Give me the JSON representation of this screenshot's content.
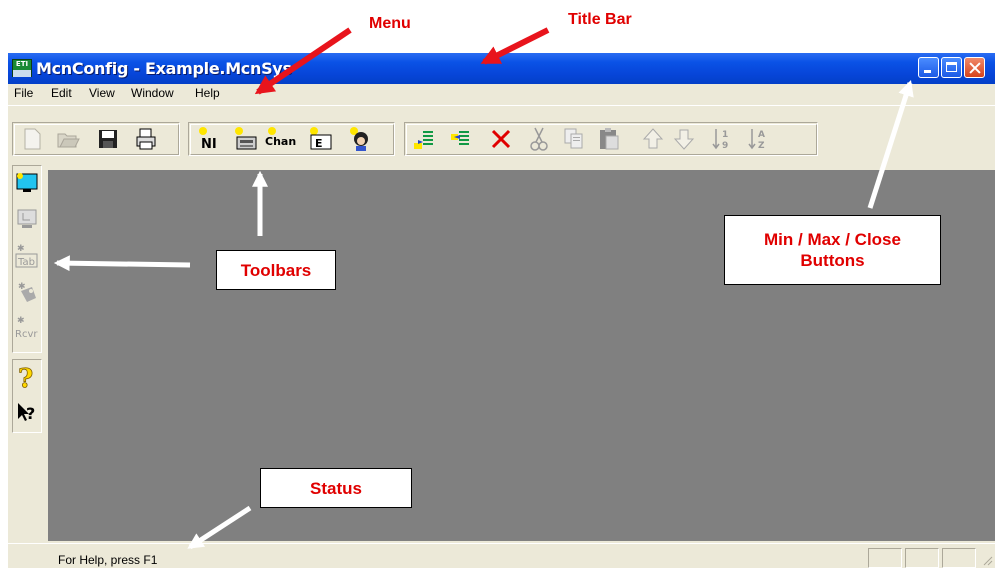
{
  "annotations": {
    "menu": "Menu",
    "title_bar": "Title Bar",
    "toolbars": "Toolbars",
    "minmaxclose_line1": "Min / Max / Close",
    "minmaxclose_line2": "Buttons",
    "status": "Status",
    "label_color": "#e00000",
    "arrow_red": "#e8141c",
    "arrow_white": "#ffffff"
  },
  "window": {
    "title": "McnConfig - Example.McnSys",
    "icon": "eti-app-icon",
    "titlebar_color": "#0a52e6",
    "client_color": "#808080"
  },
  "menu": [
    "File",
    "Edit",
    "View",
    "Window",
    "Help"
  ],
  "toolbar": {
    "buttons": [
      {
        "name": "new-icon",
        "enabled": false
      },
      {
        "name": "open-icon",
        "enabled": false
      },
      {
        "name": "save-icon",
        "enabled": true
      },
      {
        "name": "print-icon",
        "enabled": true
      },
      {
        "name": "new-ni-icon",
        "label": "NI"
      },
      {
        "name": "new-device-icon"
      },
      {
        "name": "new-channel-icon",
        "label": "Chan"
      },
      {
        "name": "new-e-icon",
        "label": "E"
      },
      {
        "name": "new-user-icon"
      },
      {
        "name": "insert-after-icon"
      },
      {
        "name": "insert-before-icon"
      },
      {
        "name": "delete-icon"
      },
      {
        "name": "cut-icon",
        "enabled": false
      },
      {
        "name": "copy-icon",
        "enabled": false
      },
      {
        "name": "paste-icon",
        "enabled": false
      },
      {
        "name": "move-up-icon",
        "enabled": false
      },
      {
        "name": "move-down-icon",
        "enabled": false
      },
      {
        "name": "sort-numeric-icon",
        "label": "1 9",
        "enabled": false
      },
      {
        "name": "sort-alpha-icon",
        "label": "A Z",
        "enabled": false
      }
    ]
  },
  "left_toolbar": {
    "tab_label": "Tab",
    "rcvr_label": "Rcvr",
    "help_glyph": "?",
    "context_help_glyph": "?"
  },
  "status": {
    "text": "For Help, press F1"
  }
}
